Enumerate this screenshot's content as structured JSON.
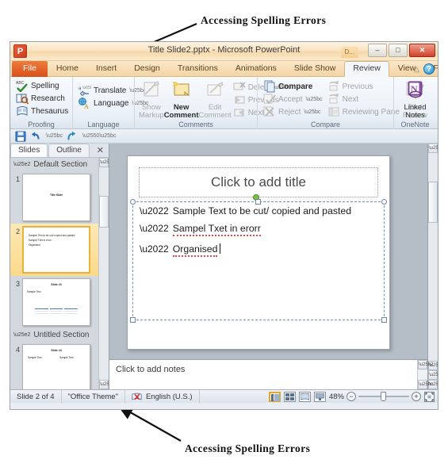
{
  "annotations": {
    "top": "Accessing Spelling Errors",
    "bottom": "Accessing Spelling Errors"
  },
  "window": {
    "logo": "P",
    "title": "Title Slide2.pptx  -  Microsoft PowerPoint",
    "contextual_tab": "D...",
    "controls": {
      "minimize": "–",
      "restore": "□",
      "close": "✕"
    }
  },
  "ribbon": {
    "tabs": [
      {
        "label": "File",
        "state": "file"
      },
      {
        "label": "Home",
        "state": "normal"
      },
      {
        "label": "Insert",
        "state": "normal"
      },
      {
        "label": "Design",
        "state": "normal"
      },
      {
        "label": "Transitions",
        "state": "normal"
      },
      {
        "label": "Animations",
        "state": "normal"
      },
      {
        "label": "Slide Show",
        "state": "normal"
      },
      {
        "label": "Review",
        "state": "active"
      },
      {
        "label": "View",
        "state": "normal"
      },
      {
        "label": "Format",
        "state": "normal"
      }
    ],
    "help_caret": "△",
    "help_label": "?",
    "groups": [
      {
        "name": "Proofing",
        "items": [
          {
            "label": "Spelling",
            "icon": "spell-check-icon",
            "enabled": true
          },
          {
            "label": "Research",
            "icon": "research-book-icon",
            "enabled": true
          },
          {
            "label": "Thesaurus",
            "icon": "thesaurus-icon",
            "enabled": true
          }
        ]
      },
      {
        "name": "Language",
        "items": [
          {
            "label": "Translate",
            "icon": "translate-icon",
            "enabled": true,
            "dropdown": true
          },
          {
            "label": "Language",
            "icon": "language-icon",
            "enabled": true,
            "dropdown": true
          }
        ]
      },
      {
        "name": "Comments",
        "items": [
          {
            "label": "Show\nMarkup",
            "label_line1": "Show",
            "label_line2": "Markup",
            "icon": "show-markup-icon",
            "enabled": false
          },
          {
            "label_line1": "New",
            "label_line2": "Comment",
            "icon": "new-comment-icon",
            "enabled": true
          },
          {
            "label_line1": "Edit",
            "label_line2": "Comment",
            "icon": "edit-comment-icon",
            "enabled": false
          },
          {
            "label": "Delete",
            "icon": "delete-comment-icon",
            "enabled": false,
            "dropdown": true
          },
          {
            "label": "Previous",
            "icon": "previous-comment-icon",
            "enabled": false
          },
          {
            "label": "Next",
            "icon": "next-comment-icon",
            "enabled": false
          }
        ]
      },
      {
        "name": "Compare",
        "items": [
          {
            "label": "Compare",
            "icon": "compare-icon",
            "enabled": true
          },
          {
            "label": "Accept",
            "icon": "accept-icon",
            "enabled": false,
            "dropdown": true
          },
          {
            "label": "Reject",
            "icon": "reject-icon",
            "enabled": false,
            "dropdown": true
          },
          {
            "label": "Previous",
            "icon": "previous-change-icon",
            "enabled": false
          },
          {
            "label": "Next",
            "icon": "next-change-icon",
            "enabled": false
          },
          {
            "label": "Reviewing Pane",
            "icon": "reviewing-pane-icon",
            "enabled": false
          },
          {
            "label_line1": "End",
            "label_line2": "Review",
            "icon": "end-review-icon",
            "enabled": false
          }
        ]
      },
      {
        "name": "OneNote",
        "items": [
          {
            "label_line1": "Linked",
            "label_line2": "Notes",
            "icon": "onenote-linked-notes-icon",
            "enabled": true
          }
        ]
      }
    ]
  },
  "qat": {
    "items": [
      {
        "icon": "save-icon",
        "label": "Save"
      },
      {
        "icon": "undo-icon",
        "label": "Undo"
      },
      {
        "icon": "redo-icon",
        "label": "Redo"
      },
      {
        "icon": "customize-qat-icon",
        "label": "Customize Quick Access Toolbar"
      }
    ]
  },
  "slides_panel": {
    "tabs": [
      {
        "label": "Slides",
        "active": true
      },
      {
        "label": "Outline",
        "active": false
      }
    ],
    "close_label": "✕",
    "sections": [
      {
        "title": "Default Section",
        "slides": [
          {
            "number": "1",
            "selected": false,
            "layout": "title",
            "title": "Title Slide"
          },
          {
            "number": "2",
            "selected": true,
            "layout": "bullets",
            "bullets": [
              "Sample Text to be cut/ copied and pasted",
              "Sampel Txet in erorr",
              "Organised"
            ]
          },
          {
            "number": "3",
            "selected": false,
            "layout": "table",
            "title": "Slide #3",
            "bullets": [
              "Sample Text"
            ],
            "table_rows": 3,
            "table_cols": 3
          }
        ]
      },
      {
        "title": "Untitled Section",
        "slides": [
          {
            "number": "4",
            "selected": false,
            "layout": "two-column",
            "title": "Slide #4",
            "bullets": [
              "Sample Text",
              "Sample Text"
            ]
          }
        ]
      }
    ]
  },
  "slide_editor": {
    "title_placeholder": "Click to add title",
    "body_lines": [
      {
        "text": "Sample Text to be cut/ copied and pasted",
        "misspelled": []
      },
      {
        "text": "Sampel Txet in erorr",
        "misspelled": [
          "Sampel",
          "Txet",
          "erorr"
        ]
      },
      {
        "text": "Organised",
        "misspelled": [
          "Organised"
        ],
        "caret": true
      }
    ]
  },
  "notes": {
    "placeholder": "Click to add notes"
  },
  "status_bar": {
    "slide_counter": "Slide 2 of 4",
    "theme": "\"Office Theme\"",
    "language": "English (U.S.)",
    "spell_status_icon": "spelling-errors-icon",
    "views": [
      {
        "name": "normal-view-button",
        "label": "Normal",
        "active": true
      },
      {
        "name": "slide-sorter-button",
        "label": "Slide Sorter",
        "active": false
      },
      {
        "name": "reading-view-button",
        "label": "Reading View",
        "active": false
      },
      {
        "name": "slideshow-button",
        "label": "Slide Show",
        "active": false
      }
    ],
    "zoom": "48%",
    "zoom_out": "−",
    "zoom_in": "+",
    "fit_label": "Fit slide to current window"
  }
}
